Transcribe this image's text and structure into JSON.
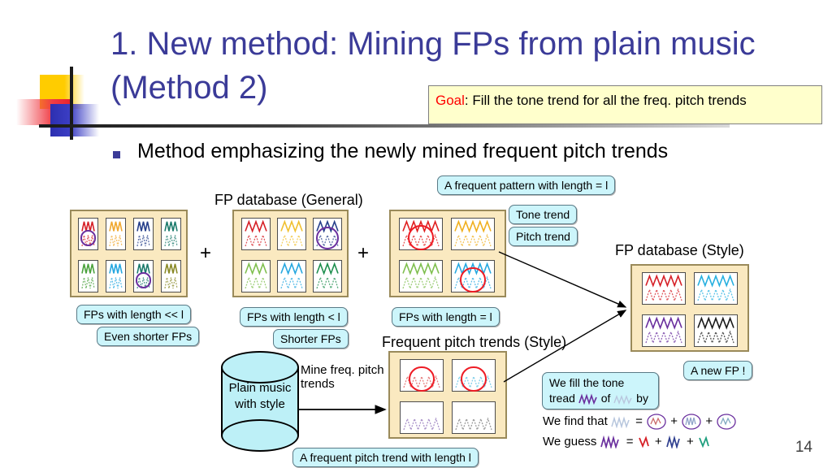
{
  "title": "1. New method: Mining FPs from plain music (Method 2)",
  "goal": {
    "label": "Goal",
    "sep": ": ",
    "text": "Fill the tone trend for all the freq. pitch trends"
  },
  "bullet": {
    "text": "Method emphasizing the newly mined frequent pitch trends"
  },
  "captions": {
    "fp_db_general": "FP database (General)",
    "fp_db_style": "FP database (Style)",
    "freq_pitch_trends_style": "Frequent pitch trends (Style)"
  },
  "operators": {
    "plus1": "+",
    "plus2": "+"
  },
  "callouts": {
    "fp_pattern_length": "A frequent pattern with length = l",
    "tone_trend": "Tone trend",
    "pitch_trend": "Pitch trend",
    "fps_much_shorter": "FPs with length << l",
    "even_shorter_fps": "Even shorter FPs",
    "fps_shorter": "FPs with length < l",
    "shorter_fps": "Shorter FPs",
    "fps_equal": "FPs with length = l",
    "a_new_fp": "A new FP !",
    "fp_pitch_trend_length": "A frequent pitch trend with length l",
    "we_fill_pre": "We fill the tone",
    "we_fill_mid": "tread",
    "we_fill_of": "of",
    "we_fill_end": "by"
  },
  "cylinder": {
    "line1": "Plain music",
    "line2": "with style"
  },
  "arrow_label": {
    "line1": "Mine freq. pitch",
    "line2": "trends"
  },
  "equations": {
    "find_label": "We find that",
    "find_eq": "=",
    "find_plus1": "+",
    "find_plus2": "+",
    "guess_label": "We guess",
    "guess_eq": "=",
    "guess_plus1": "+",
    "guess_plus2": "+"
  },
  "page_number": "14",
  "colors": {
    "title": "#3b3b98",
    "goal_accent": "#ff0000",
    "db_fill": "#fae9c0",
    "db_border": "#9a8a5a",
    "callout_fill": "#ccf5fb",
    "callout_border": "#5a7a86",
    "cylinder_fill": "#bdf0f7",
    "highlight_purple": "#6a2f9e",
    "highlight_red": "#ee1c25"
  },
  "boxes": {
    "general_a": {
      "rows": 2,
      "cols": 4,
      "cells": [
        {
          "tone": "#d62027",
          "pitch": "#d62027",
          "marked": "purple"
        },
        {
          "tone": "#f0a830",
          "pitch": "#f0a830",
          "marked": ""
        },
        {
          "tone": "#27408b",
          "pitch": "#27408b",
          "marked": ""
        },
        {
          "tone": "#1b7a6b",
          "pitch": "#1b7a6b",
          "marked": ""
        },
        {
          "tone": "#4aa23c",
          "pitch": "#4aa23c",
          "marked": ""
        },
        {
          "tone": "#27a8e0",
          "pitch": "#27a8e0",
          "marked": ""
        },
        {
          "tone": "#1b7a6b",
          "pitch": "#1b7a6b",
          "marked": "purple"
        },
        {
          "tone": "#8a8a28",
          "pitch": "#8a8a28",
          "marked": ""
        }
      ]
    },
    "general_b": {
      "rows": 2,
      "cols": 3,
      "cells": [
        {
          "tone": "#d62027",
          "pitch": "#d62027",
          "marked": ""
        },
        {
          "tone": "#f0c030",
          "pitch": "#f0c030",
          "marked": ""
        },
        {
          "tone": "#27408b",
          "pitch": "#27408b",
          "marked": "purple"
        },
        {
          "tone": "#7fbf4f",
          "pitch": "#7fbf4f",
          "marked": ""
        },
        {
          "tone": "#27a8e0",
          "pitch": "#27a8e0",
          "marked": ""
        },
        {
          "tone": "#1f8f4f",
          "pitch": "#1f8f4f",
          "marked": ""
        }
      ]
    },
    "general_c": {
      "rows": 2,
      "cols": 2,
      "cells": [
        {
          "tone": "#e02020",
          "pitch": "#e02020",
          "marked": "red"
        },
        {
          "tone": "#f0b020",
          "pitch": "#f0b020",
          "marked": ""
        },
        {
          "tone": "#7fbf4f",
          "pitch": "#7fbf4f",
          "marked": ""
        },
        {
          "tone": "#27a8e0",
          "pitch": "#27a8e0",
          "marked": "red"
        }
      ]
    },
    "style_db": {
      "rows": 2,
      "cols": 2,
      "cells": [
        {
          "tone": "#d62027",
          "pitch": "#d62027",
          "marked": ""
        },
        {
          "tone": "#27b0e0",
          "pitch": "#27b0e0",
          "marked": ""
        },
        {
          "tone": "#6a2f9e",
          "pitch": "#6a2f9e",
          "marked": ""
        },
        {
          "tone": "#1a1a1a",
          "pitch": "#1a1a1a",
          "marked": ""
        }
      ]
    },
    "pitch_trends": {
      "rows": 2,
      "cols": 2,
      "cells": [
        {
          "tone": "",
          "pitch": "#e06a6a",
          "marked": "red"
        },
        {
          "tone": "",
          "pitch": "#6ec8e6",
          "marked": "red"
        },
        {
          "tone": "",
          "pitch": "#9a7fc0",
          "marked": ""
        },
        {
          "tone": "",
          "pitch": "#8a8a8a",
          "marked": ""
        }
      ]
    }
  }
}
